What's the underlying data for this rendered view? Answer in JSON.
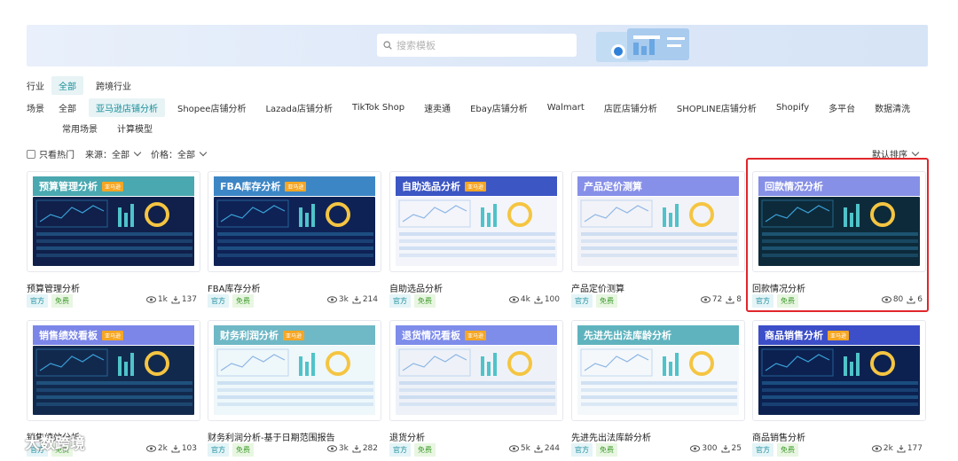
{
  "search": {
    "placeholder": "搜索模板"
  },
  "industry": {
    "label": "行业",
    "items": [
      {
        "label": "全部",
        "active": true
      },
      {
        "label": "跨境行业",
        "active": false
      }
    ]
  },
  "scene": {
    "label": "场景",
    "items": [
      {
        "label": "全部",
        "active": false
      },
      {
        "label": "亚马逊店铺分析",
        "active": true
      },
      {
        "label": "Shopee店铺分析",
        "active": false
      },
      {
        "label": "Lazada店铺分析",
        "active": false
      },
      {
        "label": "TikTok Shop",
        "active": false
      },
      {
        "label": "速卖通",
        "active": false
      },
      {
        "label": "Ebay店铺分析",
        "active": false
      },
      {
        "label": "Walmart",
        "active": false
      },
      {
        "label": "店匠店铺分析",
        "active": false
      },
      {
        "label": "SHOPLINE店铺分析",
        "active": false
      },
      {
        "label": "Shopify",
        "active": false
      },
      {
        "label": "多平台",
        "active": false
      },
      {
        "label": "数据清洗",
        "active": false
      }
    ],
    "items_row2": [
      {
        "label": "常用场景"
      },
      {
        "label": "计算模型"
      }
    ]
  },
  "filters": {
    "hot_only": "只看热门",
    "source": "来源：全部",
    "price": "价格：全部",
    "sort": "默认排序"
  },
  "tag_official": "官方",
  "tag_free": "免费",
  "cards": [
    {
      "thumb_title": "预算管理分析",
      "badge": "亚马逊",
      "title": "预算管理分析",
      "views": "1k",
      "downloads": "137",
      "head": "#4aa8b0",
      "body": "#10204a"
    },
    {
      "thumb_title": "FBA库存分析",
      "badge": "亚马逊",
      "title": "FBA库存分析",
      "views": "3k",
      "downloads": "214",
      "head": "#3d86c6",
      "body": "#0f2255"
    },
    {
      "thumb_title": "自助选品分析",
      "badge": "亚马逊",
      "title": "自助选品分析",
      "views": "4k",
      "downloads": "100",
      "head": "#3c56c4",
      "body": "#f3f5fb"
    },
    {
      "thumb_title": "产品定价测算",
      "badge": "",
      "title": "产品定价测算",
      "views": "72",
      "downloads": "8",
      "head": "#8790e8",
      "body": "#f2f3f8"
    },
    {
      "thumb_title": "回款情况分析",
      "badge": "",
      "title": "回款情况分析",
      "views": "80",
      "downloads": "6",
      "head": "#8690e6",
      "body": "#0d2a3a"
    },
    {
      "thumb_title": "销售绩效看板",
      "badge": "亚马逊",
      "title": "销售绩效分析",
      "views": "2k",
      "downloads": "103",
      "head": "#7b86e8",
      "body": "#12294e"
    },
    {
      "thumb_title": "财务利润分析",
      "badge": "亚马逊",
      "title": "财务利润分析-基于日期范围报告",
      "views": "3k",
      "downloads": "282",
      "head": "#6fb8c6",
      "body": "#eef7fa"
    },
    {
      "thumb_title": "退货情况看板",
      "badge": "亚马逊",
      "title": "退货分析",
      "views": "5k",
      "downloads": "244",
      "head": "#7e8cea",
      "body": "#eef2f8"
    },
    {
      "thumb_title": "先进先出法库龄分析",
      "badge": "",
      "title": "先进先出法库龄分析",
      "views": "300",
      "downloads": "25",
      "head": "#5fb3be",
      "body": "#f4f8fb"
    },
    {
      "thumb_title": "商品销售分析",
      "badge": "亚马逊",
      "title": "商品销售分析",
      "views": "2k",
      "downloads": "177",
      "head": "#3c4ec8",
      "body": "#0c2150"
    }
  ],
  "watermark": "大数跨境"
}
